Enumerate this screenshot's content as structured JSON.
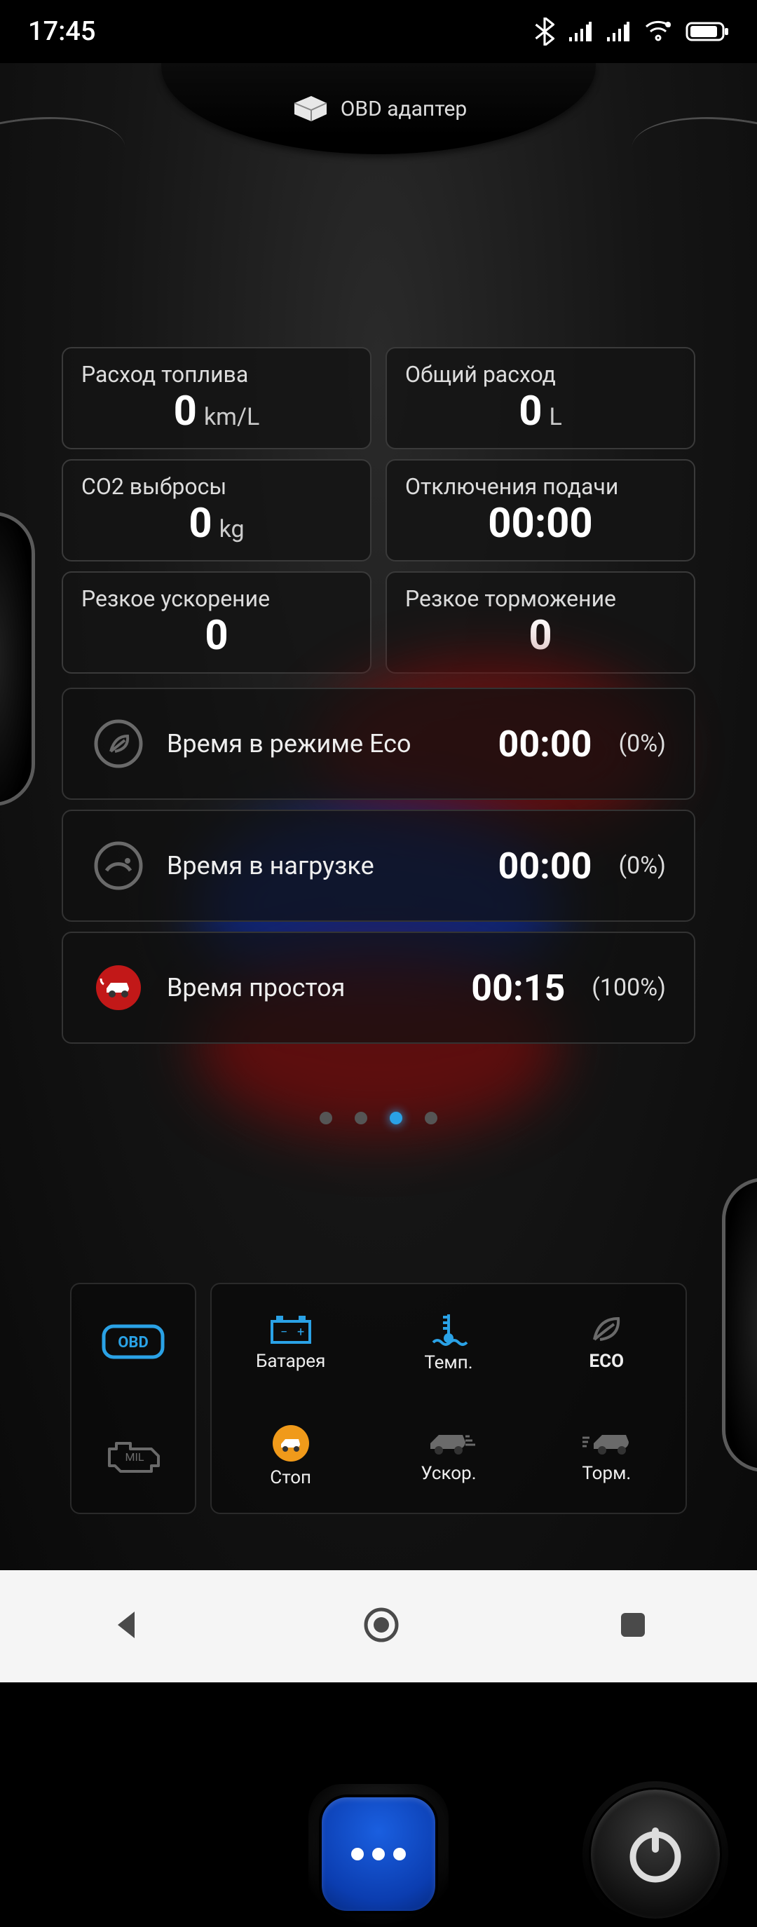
{
  "status": {
    "time": "17:45"
  },
  "header": {
    "title": "OBD адаптер"
  },
  "metrics": [
    {
      "label": "Расход топлива",
      "value": "0",
      "unit": "km/L"
    },
    {
      "label": "Общий расход",
      "value": "0",
      "unit": "L"
    },
    {
      "label": "CO2 выбросы",
      "value": "0",
      "unit": "kg"
    },
    {
      "label": "Отключения подачи",
      "value": "00:00",
      "unit": ""
    },
    {
      "label": "Резкое ускорение",
      "value": "0",
      "unit": ""
    },
    {
      "label": "Резкое торможение",
      "value": "0",
      "unit": ""
    }
  ],
  "modes": [
    {
      "icon": "leaf",
      "label": "Время в режиме Eco",
      "value": "00:00",
      "pct": "(0%)"
    },
    {
      "icon": "gauge",
      "label": "Время в нагрузке",
      "value": "00:00",
      "pct": "(0%)"
    },
    {
      "icon": "car",
      "label": "Время простоя",
      "value": "00:15",
      "pct": "(100%)"
    }
  ],
  "pager": {
    "count": 4,
    "active": 2
  },
  "widgets": {
    "side": [
      {
        "icon": "obd"
      },
      {
        "icon": "mil"
      }
    ],
    "grid": [
      {
        "icon": "battery",
        "label": "Батарея",
        "color": "#2aa2e6"
      },
      {
        "icon": "temp",
        "label": "Темп.",
        "color": "#2aa2e6"
      },
      {
        "icon": "eco",
        "label": "ECO",
        "color": "#7a7a7a"
      },
      {
        "icon": "stop",
        "label": "Стоп",
        "color": "#f09a1a"
      },
      {
        "icon": "accel",
        "label": "Ускор.",
        "color": "#7a7a7a"
      },
      {
        "icon": "brake",
        "label": "Торм.",
        "color": "#7a7a7a"
      }
    ]
  }
}
